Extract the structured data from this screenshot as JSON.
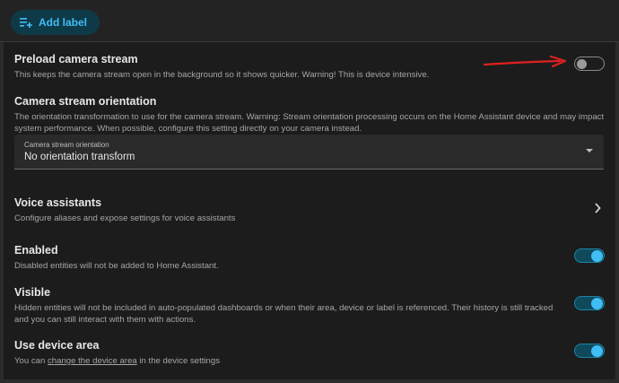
{
  "topbar": {
    "add_label": "Add label"
  },
  "preload": {
    "title": "Preload camera stream",
    "description": "This keeps the camera stream open in the background so it shows quicker. Warning! This is device intensive.",
    "enabled": false
  },
  "orientation": {
    "title": "Camera stream orientation",
    "description": "The orientation transformation to use for the camera stream. Warning: Stream orientation processing occurs on the Home Assistant device and may impact system performance. When possible, configure this setting directly on your camera instead.",
    "select_label": "Camera stream orientation",
    "select_value": "No orientation transform"
  },
  "voice": {
    "title": "Voice assistants",
    "description": "Configure aliases and expose settings for voice assistants"
  },
  "enabled_setting": {
    "title": "Enabled",
    "description": "Disabled entities will not be added to Home Assistant.",
    "enabled": true
  },
  "visible_setting": {
    "title": "Visible",
    "description": "Hidden entities will not be included in auto-populated dashboards or when their area, device or label is referenced. Their history is still tracked and you can still interact with them with actions.",
    "enabled": true
  },
  "device_area": {
    "title": "Use device area",
    "description_prefix": "You can ",
    "link_text": "change the device area",
    "description_suffix": " in the device settings",
    "enabled": true
  },
  "colors": {
    "accent": "#41bdf5",
    "arrow": "#e02020"
  }
}
